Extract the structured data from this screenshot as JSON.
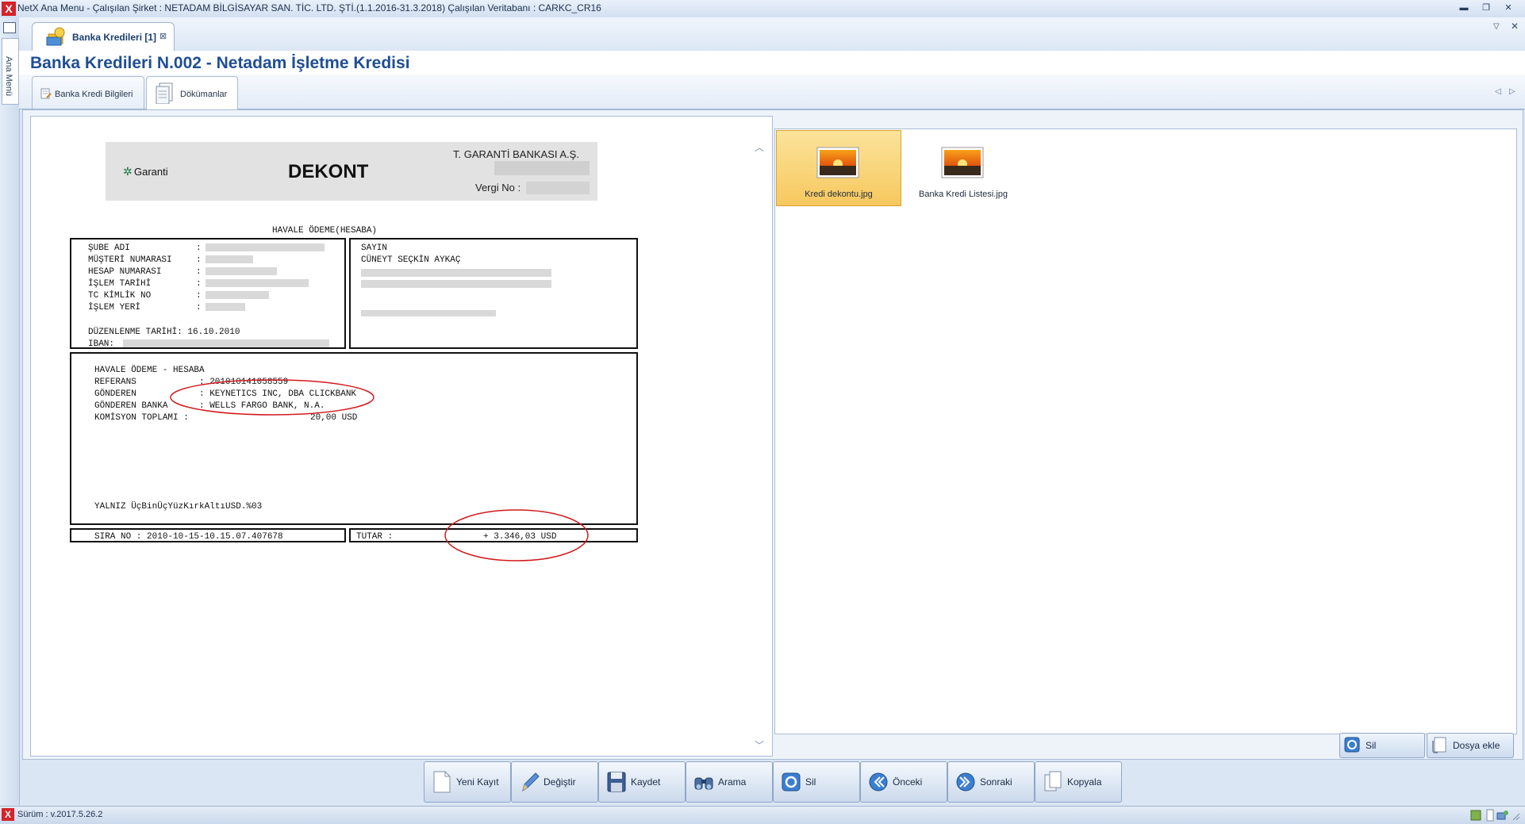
{
  "window": {
    "title": "NetX Ana Menu - Çalışılan Şirket : NETADAM BİLGİSAYAR SAN. TİC. LTD. ŞTİ.(1.1.2016-31.3.2018) Çalışılan Veritabanı : CARKC_CR16",
    "logo": "X"
  },
  "side": {
    "label": "Ana Menü"
  },
  "module_tab": {
    "label": "Banka Kredileri [1]",
    "close": "⊠"
  },
  "page": {
    "title": "Banka Kredileri N.002 - Netadam İşletme Kredisi"
  },
  "subtabs": [
    {
      "label": "Banka Kredi Bilgileri"
    },
    {
      "label": "Dökümanlar"
    }
  ],
  "document": {
    "bank_logo": "Garanti",
    "heading": "DEKONT",
    "bank_name": "T. GARANTİ BANKASI A.Ş.",
    "tax_label": "Vergi No :",
    "section_title": "HAVALE ÖDEME(HESABA)",
    "left_fields": [
      "ŞUBE ADI",
      "MÜŞTERİ NUMARASI",
      "HESAP NUMARASI",
      "İŞLEM TARİHİ",
      "TC KİMLİK NO",
      "İŞLEM YERİ"
    ],
    "issue_date": "DÜZENLENME TARİHİ: 16.10.2010",
    "iban_label": "IBAN:",
    "salutation": "SAYIN",
    "recipient": "CÜNEYT SEÇKİN AYKAÇ",
    "body_title": "HAVALE ÖDEME - HESABA",
    "body_labels": [
      "REFERANS",
      "GÖNDEREN",
      "GÖNDEREN BANKA",
      "KOMİSYON TOPLAMI :"
    ],
    "body_values": [
      ": 201010141058559",
      ": KEYNETICS INC, DBA CLICKBANK",
      ": WELLS FARGO BANK, N.A.",
      "20,00 USD"
    ],
    "amount_words": "YALNIZ ÜçBinÜçYüzKırkAltıUSD.%03",
    "sira_no": "SIRA NO : 2010-10-15-10.15.07.407678",
    "tutar_label": "TUTAR :",
    "tutar_value": "+ 3.346,03 USD"
  },
  "files": [
    {
      "name": "Kredi dekontu.jpg",
      "selected": true
    },
    {
      "name": "Banka Kredi Listesi.jpg",
      "selected": false
    }
  ],
  "file_buttons": {
    "delete": "Sil",
    "add": "Dosya ekle"
  },
  "toolbar": [
    {
      "label": "Yeni Kayıt",
      "icon": "new-record-icon"
    },
    {
      "label": "Değiştir",
      "icon": "edit-icon"
    },
    {
      "label": "Kaydet",
      "icon": "save-icon"
    },
    {
      "label": "Arama",
      "icon": "search-icon"
    },
    {
      "label": "Sil",
      "icon": "delete-icon"
    },
    {
      "label": "Önceki",
      "icon": "previous-icon"
    },
    {
      "label": "Sonraki",
      "icon": "next-icon"
    },
    {
      "label": "Kopyala",
      "icon": "copy-icon"
    }
  ],
  "status": {
    "version": "Sürüm : v.2017.5.26.2"
  }
}
